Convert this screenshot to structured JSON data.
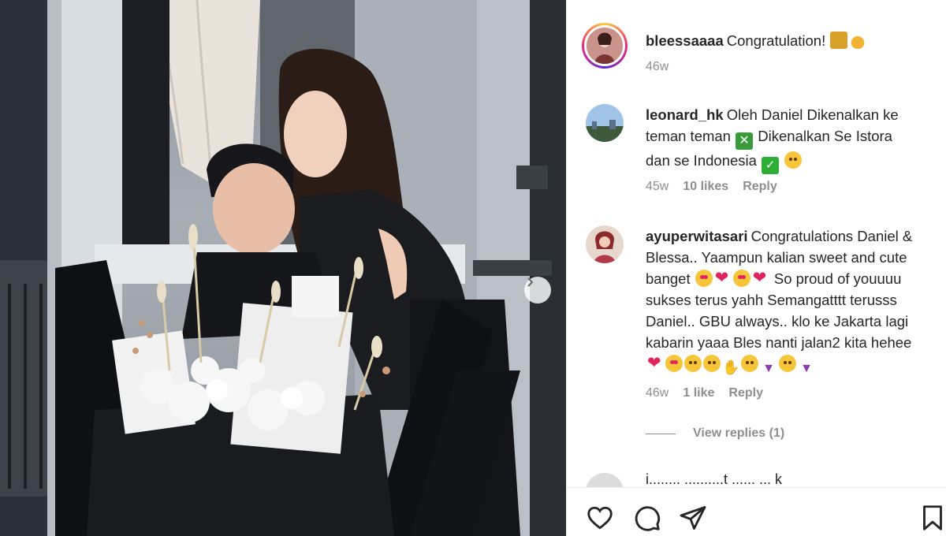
{
  "post": {
    "image_alt": "",
    "carousel_next_icon": "chevron-right-icon"
  },
  "comments": [
    {
      "username": "bleessaaaa",
      "text": "Congratulation!",
      "time": "46w"
    },
    {
      "username": "leonard_hk",
      "line1": "Oleh Daniel Dikenalkan ke",
      "line2": "teman teman",
      "line2b": "Dikenalkan Se Istora",
      "line3": "dan se Indonesia",
      "time": "45w",
      "likes": "10 likes",
      "reply": "Reply"
    },
    {
      "username": "ayuperwitasari",
      "line1": "Congratulations Daniel &",
      "line2": "Blessa.. Yaampun kalian sweet and cute",
      "line3": "banget",
      "line3b": "So proud of youuuu",
      "line4": "sukses terus yahh Semangatttt terusss",
      "line5": "Daniel.. GBU always.. klo ke Jakarta lagi",
      "line6": "kabarin yaaa Bles nanti jalan2 kita hehee",
      "time": "46w",
      "likes": "1 like",
      "reply": "Reply"
    }
  ],
  "view_replies": "View replies (1)",
  "next_comment_partial": "i........ ..........t ...... ... k",
  "actions": {
    "like": "heart-icon",
    "comment": "comment-icon",
    "share": "send-icon",
    "save": "bookmark-icon"
  },
  "colors": {
    "text": "#262626",
    "muted": "#8e8e8e",
    "heart_red": "#e0245e"
  }
}
